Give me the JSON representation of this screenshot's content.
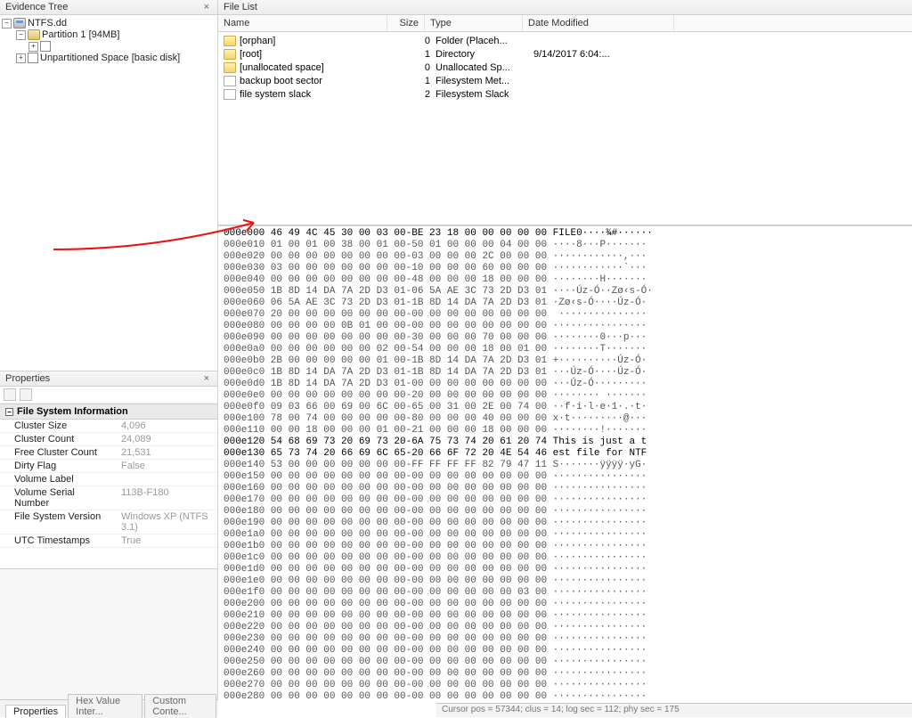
{
  "evidenceTree": {
    "title": "Evidence Tree",
    "root": "NTFS.dd",
    "partition": "Partition 1 [94MB]",
    "unpartitioned": "Unpartitioned Space [basic disk]"
  },
  "fileList": {
    "title": "File List",
    "columns": {
      "name": "Name",
      "size": "Size",
      "type": "Type",
      "date": "Date Modified"
    },
    "rows": [
      {
        "icon": "folder",
        "name": "[orphan]",
        "size": "0",
        "type": "Folder (Placeh...",
        "date": ""
      },
      {
        "icon": "folder",
        "name": "[root]",
        "size": "1",
        "type": "Directory",
        "date": "9/14/2017 6:04:..."
      },
      {
        "icon": "folder",
        "name": "[unallocated space]",
        "size": "0",
        "type": "Unallocated Sp...",
        "date": ""
      },
      {
        "icon": "file",
        "name": "backup boot sector",
        "size": "1",
        "type": "Filesystem Met...",
        "date": ""
      },
      {
        "icon": "file",
        "name": "file system slack",
        "size": "2",
        "type": "Filesystem Slack",
        "date": ""
      }
    ]
  },
  "properties": {
    "title": "Properties",
    "group": "File System Information",
    "rows": [
      {
        "k": "Cluster Size",
        "v": "4,096"
      },
      {
        "k": "Cluster Count",
        "v": "24,089"
      },
      {
        "k": "Free Cluster Count",
        "v": "21,531"
      },
      {
        "k": "Dirty Flag",
        "v": "False"
      },
      {
        "k": "Volume Label",
        "v": ""
      },
      {
        "k": "Volume Serial Number",
        "v": "113B-F180"
      },
      {
        "k": "File System Version",
        "v": "Windows XP (NTFS 3.1)"
      },
      {
        "k": "UTC Timestamps",
        "v": "True"
      }
    ]
  },
  "bottomTabs": {
    "active": "Properties",
    "tab2": "Hex Value Inter...",
    "tab3": "Custom Conte..."
  },
  "hex": {
    "lines": [
      {
        "off": "000e000",
        "hex": "46 49 4C 45 30 00 03 00-BE 23 18 00 00 00 00 00",
        "asc": "FILE0····¾#······"
      },
      {
        "off": "000e010",
        "hex": "01 00 01 00 38 00 01 00-50 01 00 00 00 04 00 00",
        "asc": "····8···P·······"
      },
      {
        "off": "000e020",
        "hex": "00 00 00 00 00 00 00 00-03 00 00 00 2C 00 00 00",
        "asc": "············,···"
      },
      {
        "off": "000e030",
        "hex": "03 00 00 00 00 00 00 00-10 00 00 00 60 00 00 00",
        "asc": "············`···"
      },
      {
        "off": "000e040",
        "hex": "00 00 00 00 00 00 00 00-48 00 00 00 18 00 00 00",
        "asc": "········H·······"
      },
      {
        "off": "000e050",
        "hex": "1B 8D 14 DA 7A 2D D3 01-06 5A AE 3C 73 2D D3 01",
        "asc": "····Úz-Ó··Zø‹s-Ó·"
      },
      {
        "off": "000e060",
        "hex": "06 5A AE 3C 73 2D D3 01-1B 8D 14 DA 7A 2D D3 01",
        "asc": "·Zø‹s-Ó····Úz-Ó·"
      },
      {
        "off": "000e070",
        "hex": "20 00 00 00 00 00 00 00-00 00 00 00 00 00 00 00",
        "asc": " ···············"
      },
      {
        "off": "000e080",
        "hex": "00 00 00 00 0B 01 00 00-00 00 00 00 00 00 00 00",
        "asc": "················"
      },
      {
        "off": "000e090",
        "hex": "00 00 00 00 00 00 00 00-30 00 00 00 70 00 00 00",
        "asc": "········0···p···"
      },
      {
        "off": "000e0a0",
        "hex": "00 00 00 00 00 00 02 00-54 00 00 00 18 00 01 00",
        "asc": "········T·······"
      },
      {
        "off": "000e0b0",
        "hex": "2B 00 00 00 00 00 01 00-1B 8D 14 DA 7A 2D D3 01",
        "asc": "+··········Úz-Ó·"
      },
      {
        "off": "000e0c0",
        "hex": "1B 8D 14 DA 7A 2D D3 01-1B 8D 14 DA 7A 2D D3 01",
        "asc": "···Úz-Ó····Úz-Ó·"
      },
      {
        "off": "000e0d0",
        "hex": "1B 8D 14 DA 7A 2D D3 01-00 00 00 00 00 00 00 00",
        "asc": "···Úz-Ó·········"
      },
      {
        "off": "000e0e0",
        "hex": "00 00 00 00 00 00 00 00-20 00 00 00 00 00 00 00",
        "asc": "········ ·······"
      },
      {
        "off": "000e0f0",
        "hex": "09 03 66 00 69 00 6C 00-65 00 31 00 2E 00 74 00",
        "asc": "··f·i·l·e·1·.·t·"
      },
      {
        "off": "000e100",
        "hex": "78 00 74 00 00 00 00 00-80 00 00 00 40 00 00 00",
        "asc": "x·t·········@···"
      },
      {
        "off": "000e110",
        "hex": "00 00 18 00 00 00 01 00-21 00 00 00 18 00 00 00",
        "asc": "········!·······"
      },
      {
        "off": "000e120",
        "hex": "54 68 69 73 20 69 73 20-6A 75 73 74 20 61 20 74",
        "asc": "This is just a t"
      },
      {
        "off": "000e130",
        "hex": "65 73 74 20 66 69 6C 65-20 66 6F 72 20 4E 54 46",
        "asc": "est file for NTF"
      },
      {
        "off": "000e140",
        "hex": "53 00 00 00 00 00 00 00-FF FF FF FF 82 79 47 11",
        "asc": "S·······ÿÿÿÿ·yG·"
      },
      {
        "off": "000e150",
        "hex": "00 00 00 00 00 00 00 00-00 00 00 00 00 00 00 00",
        "asc": "················"
      },
      {
        "off": "000e160",
        "hex": "00 00 00 00 00 00 00 00-00 00 00 00 00 00 00 00",
        "asc": "················"
      },
      {
        "off": "000e170",
        "hex": "00 00 00 00 00 00 00 00-00 00 00 00 00 00 00 00",
        "asc": "················"
      },
      {
        "off": "000e180",
        "hex": "00 00 00 00 00 00 00 00-00 00 00 00 00 00 00 00",
        "asc": "················"
      },
      {
        "off": "000e190",
        "hex": "00 00 00 00 00 00 00 00-00 00 00 00 00 00 00 00",
        "asc": "················"
      },
      {
        "off": "000e1a0",
        "hex": "00 00 00 00 00 00 00 00-00 00 00 00 00 00 00 00",
        "asc": "················"
      },
      {
        "off": "000e1b0",
        "hex": "00 00 00 00 00 00 00 00-00 00 00 00 00 00 00 00",
        "asc": "················"
      },
      {
        "off": "000e1c0",
        "hex": "00 00 00 00 00 00 00 00-00 00 00 00 00 00 00 00",
        "asc": "················"
      },
      {
        "off": "000e1d0",
        "hex": "00 00 00 00 00 00 00 00-00 00 00 00 00 00 00 00",
        "asc": "················"
      },
      {
        "off": "000e1e0",
        "hex": "00 00 00 00 00 00 00 00-00 00 00 00 00 00 00 00",
        "asc": "················"
      },
      {
        "off": "000e1f0",
        "hex": "00 00 00 00 00 00 00 00-00 00 00 00 00 00 03 00",
        "asc": "················"
      },
      {
        "off": "000e200",
        "hex": "00 00 00 00 00 00 00 00-00 00 00 00 00 00 00 00",
        "asc": "················"
      },
      {
        "off": "000e210",
        "hex": "00 00 00 00 00 00 00 00-00 00 00 00 00 00 00 00",
        "asc": "················"
      },
      {
        "off": "000e220",
        "hex": "00 00 00 00 00 00 00 00-00 00 00 00 00 00 00 00",
        "asc": "················"
      },
      {
        "off": "000e230",
        "hex": "00 00 00 00 00 00 00 00-00 00 00 00 00 00 00 00",
        "asc": "················"
      },
      {
        "off": "000e240",
        "hex": "00 00 00 00 00 00 00 00-00 00 00 00 00 00 00 00",
        "asc": "················"
      },
      {
        "off": "000e250",
        "hex": "00 00 00 00 00 00 00 00-00 00 00 00 00 00 00 00",
        "asc": "················"
      },
      {
        "off": "000e260",
        "hex": "00 00 00 00 00 00 00 00-00 00 00 00 00 00 00 00",
        "asc": "················"
      },
      {
        "off": "000e270",
        "hex": "00 00 00 00 00 00 00 00-00 00 00 00 00 00 00 00",
        "asc": "················"
      },
      {
        "off": "000e280",
        "hex": "00 00 00 00 00 00 00 00-00 00 00 00 00 00 00 00",
        "asc": "················"
      }
    ]
  },
  "status": "Cursor pos = 57344; clus = 14; log sec = 112; phy sec = 175"
}
